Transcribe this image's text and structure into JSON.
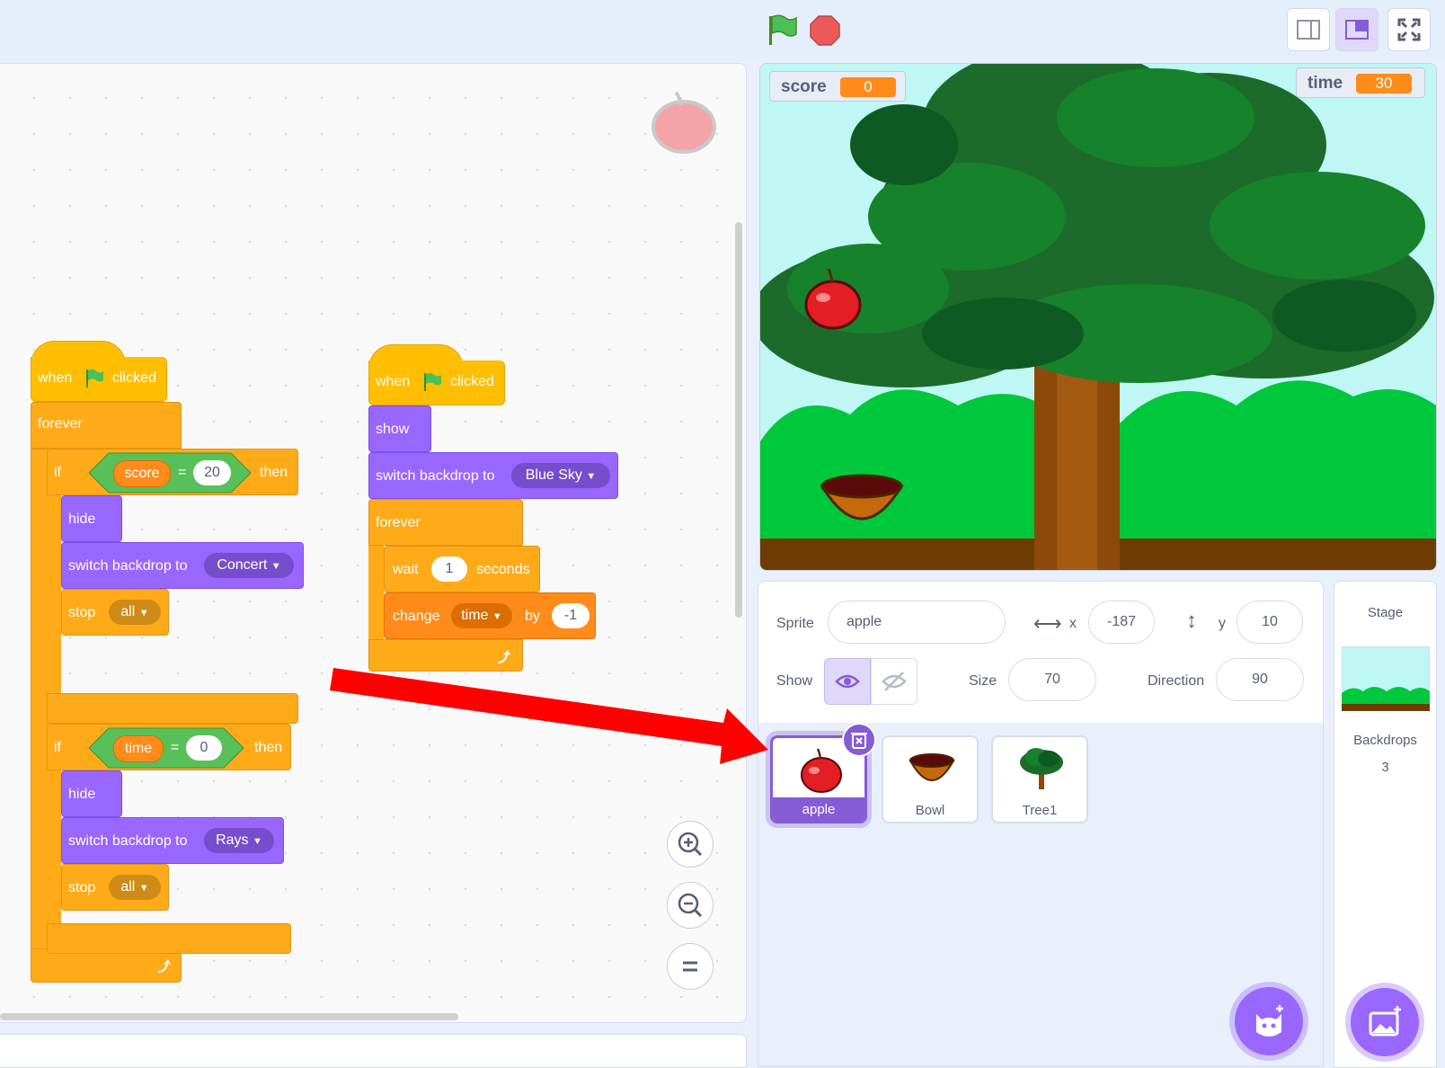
{
  "toolbar": {
    "icons": [
      "green-flag-icon",
      "stop-icon",
      "small-stage-icon",
      "normal-stage-icon",
      "fullscreen-icon"
    ]
  },
  "script1": {
    "hat": {
      "when": "when",
      "clicked": "clicked"
    },
    "forever": "forever",
    "if1": {
      "if": "if",
      "var": "score",
      "eq": "=",
      "value": "20",
      "then": "then"
    },
    "hide1": "hide",
    "switch1": {
      "label": "switch backdrop to",
      "option": "Concert"
    },
    "stop1": {
      "label": "stop",
      "option": "all"
    },
    "if2": {
      "if": "if",
      "var": "time",
      "eq": "=",
      "value": "0",
      "then": "then"
    },
    "hide2": "hide",
    "switch2": {
      "label": "switch backdrop to",
      "option": "Rays"
    },
    "stop2": {
      "label": "stop",
      "option": "all"
    }
  },
  "script2": {
    "hat": {
      "when": "when",
      "clicked": "clicked"
    },
    "show": "show",
    "switch": {
      "label": "switch backdrop to",
      "option": "Blue Sky"
    },
    "forever": "forever",
    "wait": {
      "label": "wait",
      "value": "1",
      "unit": "seconds"
    },
    "change": {
      "label": "change",
      "var": "time",
      "by": "by",
      "value": "-1"
    }
  },
  "stage": {
    "monitors": {
      "score": {
        "label": "score",
        "value": "0"
      },
      "time": {
        "label": "time",
        "value": "30"
      }
    }
  },
  "sprite_info": {
    "sprite_label": "Sprite",
    "sprite_name": "apple",
    "x_label": "x",
    "x": "-187",
    "y_label": "y",
    "y": "10",
    "show_label": "Show",
    "size_label": "Size",
    "size": "70",
    "direction_label": "Direction",
    "direction": "90"
  },
  "sprites": [
    {
      "name": "apple",
      "selected": true
    },
    {
      "name": "Bowl",
      "selected": false
    },
    {
      "name": "Tree1",
      "selected": false
    }
  ],
  "stage_panel": {
    "title": "Stage",
    "backdrops_label": "Backdrops",
    "backdrops_count": "3"
  },
  "colors": {
    "events": "#ffbf00",
    "control": "#ffab19",
    "looks": "#9966ff",
    "variables": "#ff8c1a",
    "operators": "#59c059",
    "annotation_arrow": "#ff0000"
  }
}
